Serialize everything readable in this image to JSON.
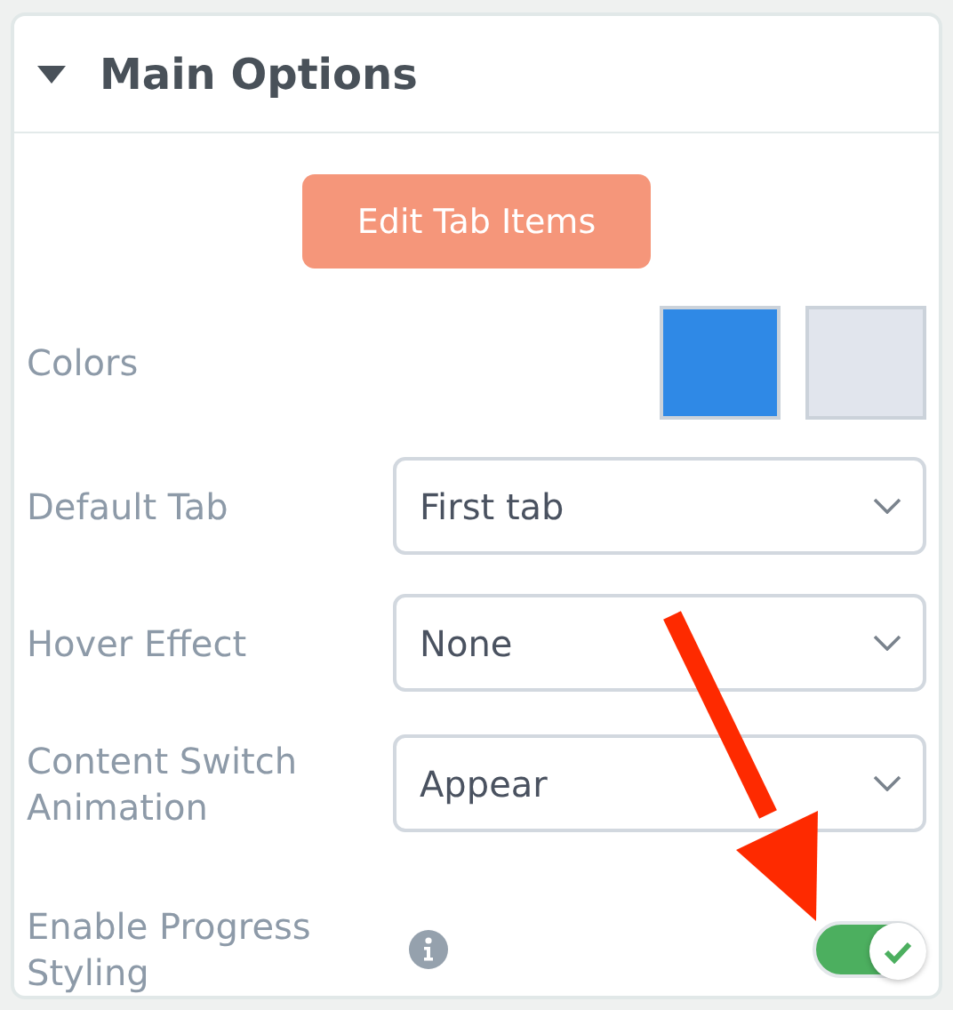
{
  "section": {
    "title": "Main Options",
    "expanded": true
  },
  "edit_button": "Edit Tab Items",
  "colors": {
    "label": "Colors",
    "swatches": [
      {
        "color": "#2f89e6"
      },
      {
        "color": "#e1e5ed"
      }
    ]
  },
  "selects": [
    {
      "label": "Default Tab",
      "value": "First tab"
    },
    {
      "label": "Hover Effect",
      "value": "None"
    },
    {
      "label": "Content Switch Animation",
      "value": "Appear"
    }
  ],
  "toggle": {
    "label": "Enable Progress Styling",
    "on": true
  }
}
